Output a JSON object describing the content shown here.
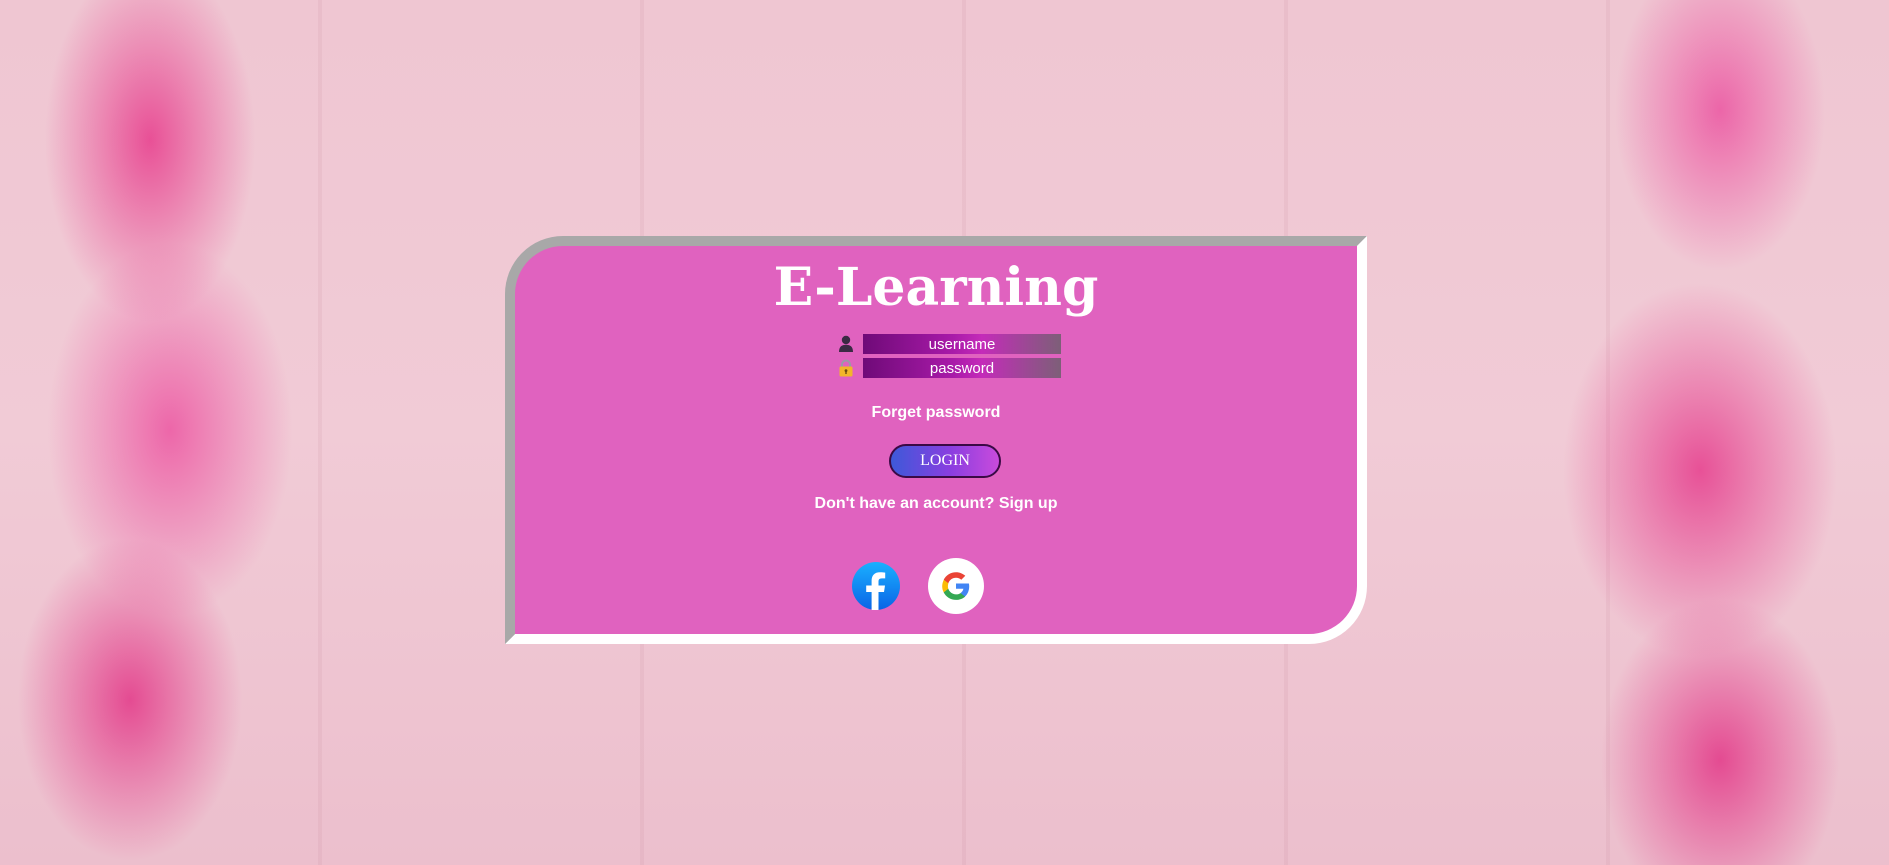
{
  "app": {
    "title": "E-Learning"
  },
  "form": {
    "username_placeholder": "username",
    "username_value": "",
    "password_placeholder": "password",
    "password_value": "",
    "username_icon": "user-icon",
    "password_icon": "lock-icon",
    "forgot_label": "Forget password",
    "login_label": "LOGIN",
    "signup_prefix": "Don't have an account?",
    "signup_link": "Sign up"
  },
  "social": {
    "facebook_icon": "facebook-icon",
    "google_icon": "google-icon"
  },
  "colors": {
    "card_background": "#e062bf",
    "card_border_dark": "#a8a8a8",
    "card_border_light": "#ffffff",
    "title_text": "#ffffff",
    "login_gradient_start": "#3d59d9",
    "login_gradient_end": "#c94bdc"
  }
}
